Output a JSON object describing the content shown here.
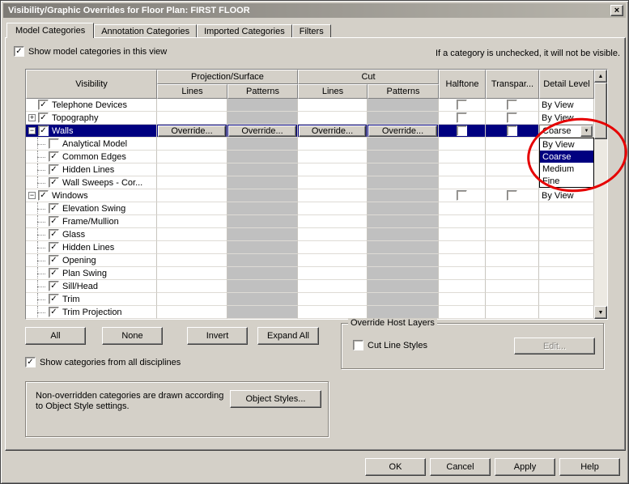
{
  "window": {
    "title": "Visibility/Graphic Overrides for Floor Plan: FIRST FLOOR"
  },
  "icons": {
    "close": "×",
    "check": "✓",
    "dropdown": "▼",
    "scroll_up": "▲",
    "scroll_down": "▼",
    "expand": "+",
    "collapse": "−"
  },
  "colors": {
    "selection": "#000080",
    "annotation": "#e60000",
    "dialog_bg": "#d4d0c8",
    "pattern_column_bg": "#c0c0c0"
  },
  "tabs": {
    "items": [
      {
        "label": "Model Categories",
        "active": true
      },
      {
        "label": "Annotation Categories",
        "active": false
      },
      {
        "label": "Imported Categories",
        "active": false
      },
      {
        "label": "Filters",
        "active": false
      }
    ]
  },
  "top_bar": {
    "show_model_categories_label": "Show model categories in this view",
    "show_model_categories_checked": true,
    "unchecked_hint": "If a category is unchecked, it will not be visible."
  },
  "grid": {
    "headers": {
      "visibility": "Visibility",
      "projection_surface": "Projection/Surface",
      "cut": "Cut",
      "lines": "Lines",
      "patterns": "Patterns",
      "halftone": "Halftone",
      "transparent": "Transpar...",
      "detail_level": "Detail Level"
    },
    "override_button_label": "Override...",
    "rows": [
      {
        "name": "Telephone Devices",
        "indent": 0,
        "expander": "",
        "checked": true,
        "option_cbs": true,
        "detail": "By View"
      },
      {
        "name": "Topography",
        "indent": 0,
        "expander": "+",
        "checked": true,
        "option_cbs": true,
        "detail": "By View"
      },
      {
        "name": "Walls",
        "indent": 0,
        "expander": "-",
        "checked": true,
        "selected": true,
        "overrides": true,
        "option_cbs": true,
        "combo": true
      },
      {
        "name": "Analytical Model",
        "indent": 1,
        "checked": false
      },
      {
        "name": "Common Edges",
        "indent": 1,
        "checked": true
      },
      {
        "name": "Hidden Lines",
        "indent": 1,
        "checked": true
      },
      {
        "name": "Wall Sweeps - Cor...",
        "indent": 1,
        "checked": true
      },
      {
        "name": "Windows",
        "indent": 0,
        "expander": "-",
        "checked": true,
        "option_cbs": true,
        "detail": "By View"
      },
      {
        "name": "Elevation Swing",
        "indent": 1,
        "checked": true
      },
      {
        "name": "Frame/Mullion",
        "indent": 1,
        "checked": true
      },
      {
        "name": "Glass",
        "indent": 1,
        "checked": true
      },
      {
        "name": "Hidden Lines",
        "indent": 1,
        "checked": true
      },
      {
        "name": "Opening",
        "indent": 1,
        "checked": true
      },
      {
        "name": "Plan Swing",
        "indent": 1,
        "checked": true
      },
      {
        "name": "Sill/Head",
        "indent": 1,
        "checked": true
      },
      {
        "name": "Trim",
        "indent": 1,
        "checked": true
      },
      {
        "name": "Trim Projection",
        "indent": 1,
        "checked": true
      }
    ]
  },
  "detail_dropdown": {
    "value": "Coarse",
    "options": [
      "By View",
      "Coarse",
      "Medium",
      "Fine"
    ],
    "selected_index": 1
  },
  "actions": {
    "all": "All",
    "none": "None",
    "invert": "Invert",
    "expand_all": "Expand All"
  },
  "disciplines": {
    "label": "Show categories from all disciplines",
    "checked": true
  },
  "override_host_layers": {
    "title": "Override Host Layers",
    "cut_line_styles_label": "Cut Line Styles",
    "cut_line_styles_checked": false,
    "edit_label": "Edit..."
  },
  "info_box": {
    "text": "Non-overridden categories are drawn according to Object Style settings.",
    "object_styles_label": "Object Styles..."
  },
  "footer": {
    "ok": "OK",
    "cancel": "Cancel",
    "apply": "Apply",
    "help": "Help"
  }
}
